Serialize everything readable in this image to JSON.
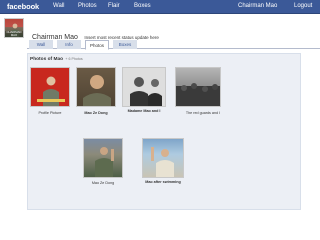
{
  "topbar": {
    "brand": "facebook",
    "nav": [
      "Wall",
      "Photos",
      "Flair",
      "Boxes"
    ],
    "user_name": "Chairman Mao",
    "logout": "Logout"
  },
  "profile": {
    "picture_label": "CHAIRMAN MAO",
    "name": "Chairman Mao",
    "status_prompt": "Insert most recent status update here"
  },
  "tabs": [
    "Wall",
    "Info",
    "Photos",
    "Boxes"
  ],
  "active_tab": "Photos",
  "album": {
    "title": "Photos of Mao",
    "count": "+ 6 Photos",
    "photos": [
      {
        "caption": "Profile Picture",
        "bold": false
      },
      {
        "caption": "Mao Ze Dong",
        "bold": true
      },
      {
        "caption": "Madame Mao and I",
        "bold": true
      },
      {
        "caption": "The red guards and I",
        "bold": false
      },
      {
        "caption": "Mao Ze Dong",
        "bold": false
      },
      {
        "caption": "Mao after swimming",
        "bold": true
      }
    ]
  },
  "colors": {
    "topbar": "#3b5998",
    "tab_inactive": "#d8dfea",
    "panel": "#eceff5"
  }
}
